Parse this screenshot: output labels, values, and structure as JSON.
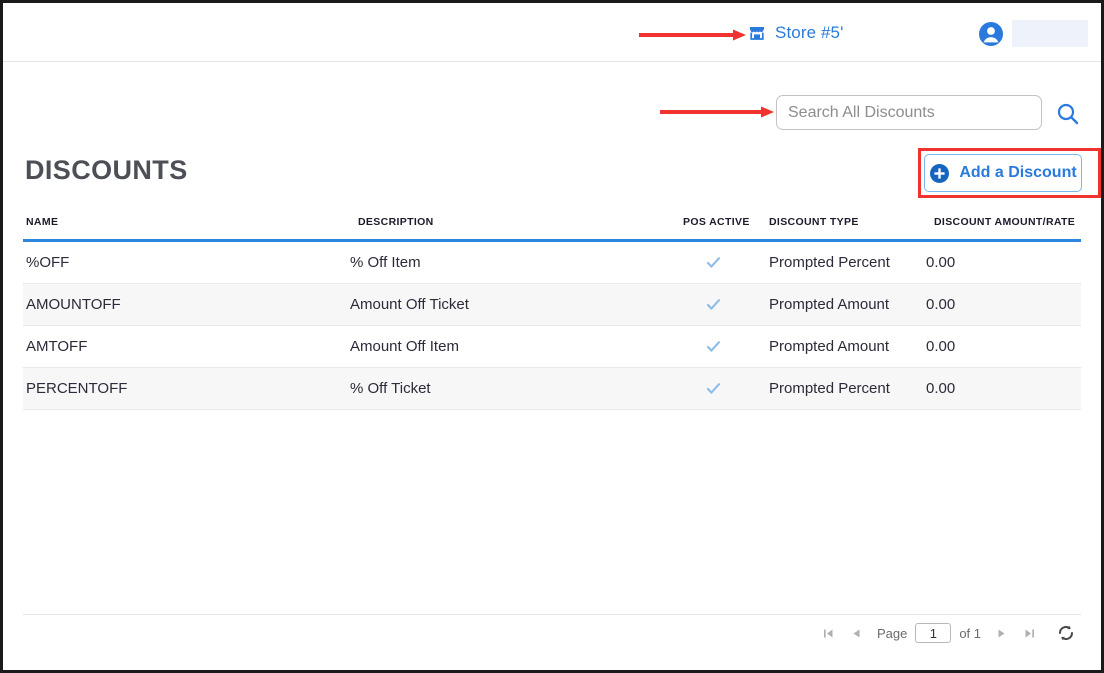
{
  "header": {
    "store_icon": "storefront-icon",
    "store_label": "Store #5'",
    "avatar_icon": "user-avatar-icon",
    "user_name": ""
  },
  "search": {
    "placeholder": "Search All Discounts",
    "value": "",
    "icon": "search-icon"
  },
  "page": {
    "title": "DISCOUNTS",
    "add_button_label": "Add a Discount",
    "add_button_icon": "plus-circle-icon"
  },
  "table": {
    "columns": [
      "NAME",
      "DESCRIPTION",
      "POS ACTIVE",
      "DISCOUNT TYPE",
      "DISCOUNT AMOUNT/RATE"
    ],
    "rows": [
      {
        "name": "%OFF",
        "description": "% Off Item",
        "pos_active": true,
        "discount_type": "Prompted Percent",
        "amount_rate": "0.00"
      },
      {
        "name": "AMOUNTOFF",
        "description": "Amount Off Ticket",
        "pos_active": true,
        "discount_type": "Prompted Amount",
        "amount_rate": "0.00"
      },
      {
        "name": "AMTOFF",
        "description": "Amount Off Item",
        "pos_active": true,
        "discount_type": "Prompted Amount",
        "amount_rate": "0.00"
      },
      {
        "name": "PERCENTOFF",
        "description": "% Off Ticket",
        "pos_active": true,
        "discount_type": "Prompted Percent",
        "amount_rate": "0.00"
      }
    ]
  },
  "pagination": {
    "first_icon": "first-page-icon",
    "prev_icon": "previous-page-icon",
    "page_label": "Page",
    "page_value": "1",
    "of_label": "of 1",
    "next_icon": "next-page-icon",
    "last_icon": "last-page-icon",
    "refresh_icon": "refresh-icon"
  },
  "colors": {
    "accent_blue": "#2a7ade",
    "header_rule_blue": "#2e86de",
    "annotation_red": "#f0332e",
    "check_blue": "#8cbce8",
    "title_gray": "#4c4f56"
  }
}
